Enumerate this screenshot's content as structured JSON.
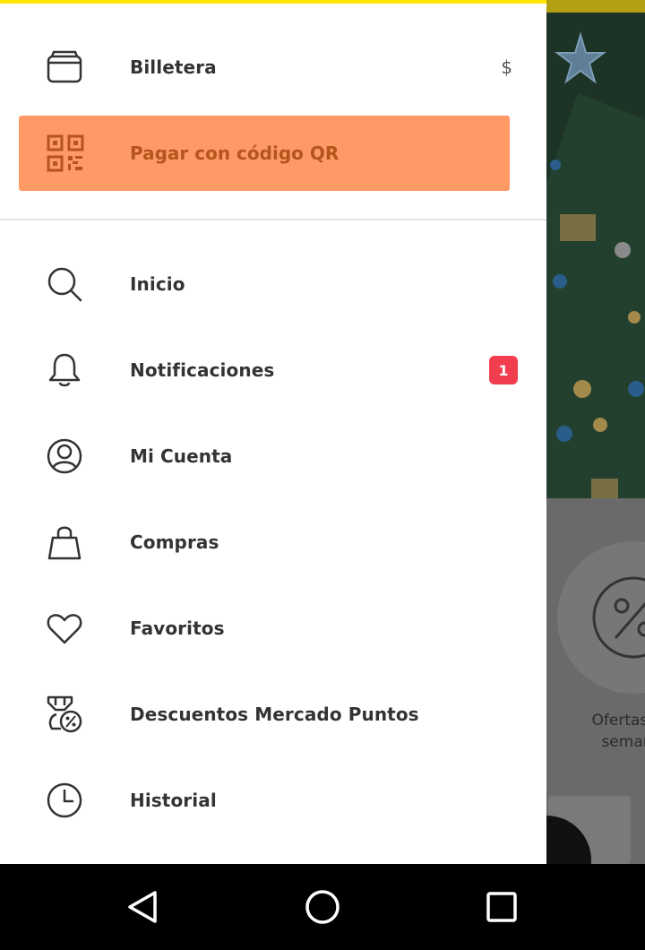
{
  "background_app": {
    "offer_text_line1": "Ofertas d",
    "offer_text_line2": "seman"
  },
  "drawer": {
    "wallet": {
      "label": "Billetera",
      "right_symbol": "$",
      "icon": "wallet-icon"
    },
    "qr": {
      "label": "Pagar con código QR",
      "icon": "qr-code-icon",
      "bg_color": "#ff9966",
      "text_color": "#b5541d"
    },
    "items": [
      {
        "label": "Inicio",
        "icon": "search-icon"
      },
      {
        "label": "Notificaciones",
        "icon": "bell-icon",
        "badge": "1"
      },
      {
        "label": "Mi Cuenta",
        "icon": "user-circle-icon"
      },
      {
        "label": "Compras",
        "icon": "shopping-bag-icon"
      },
      {
        "label": "Favoritos",
        "icon": "heart-icon"
      },
      {
        "label": "Descuentos Mercado Puntos",
        "icon": "medal-discount-icon"
      },
      {
        "label": "Historial",
        "icon": "clock-icon"
      }
    ]
  },
  "colors": {
    "brand_yellow": "#ffe600",
    "badge_red": "#f23d4f"
  },
  "system_nav": {
    "back": "back-triangle-icon",
    "home": "home-circle-icon",
    "recents": "recents-square-icon"
  }
}
